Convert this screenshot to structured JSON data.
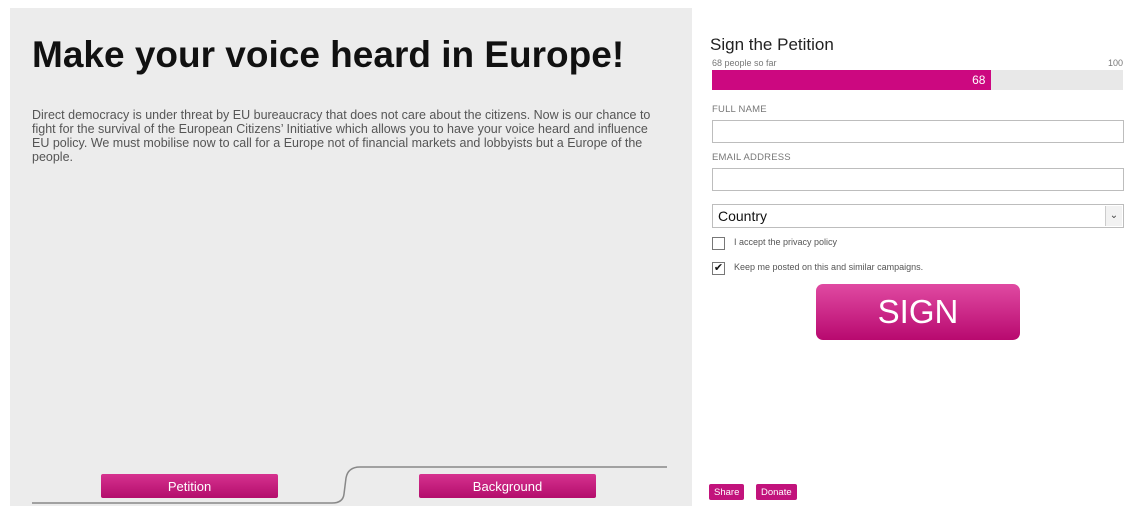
{
  "main": {
    "headline": "Make your voice heard in Europe!",
    "intro": "Direct democracy is under threat by EU bureaucracy that does not care about the citizens. Now is our chance to fight for the survival of the European Citizens’ Initiative which allows you to have your voice heard and influence EU policy. We must mobilise now to call for a Europe not of financial markets and lobbyists but a Europe of the people.",
    "tabs": [
      {
        "label": "Petition"
      },
      {
        "label": "Background"
      }
    ]
  },
  "petition": {
    "title": "Sign the Petition",
    "count_text": "68 people so far",
    "goal": "100",
    "signatures": "68",
    "progress_fraction": 0.68,
    "full_name_label": "FULL NAME",
    "full_name_value": "",
    "email_label": "EMAIL ADDRESS",
    "email_value": "",
    "country_selected": "Country",
    "privacy_label": "I accept the privacy policy",
    "privacy_checked": false,
    "keep_posted_label": "Keep me posted on this and similar campaigns.",
    "keep_posted_checked": true,
    "sign_label": "SIGN",
    "share_label": "Share",
    "donate_label": "Donate"
  },
  "colors": {
    "accent": "#cc0880",
    "left_panel": "#ececec"
  },
  "icons": {
    "select_arrow": "chevron-down-icon",
    "checkmark": "checkmark-icon"
  }
}
